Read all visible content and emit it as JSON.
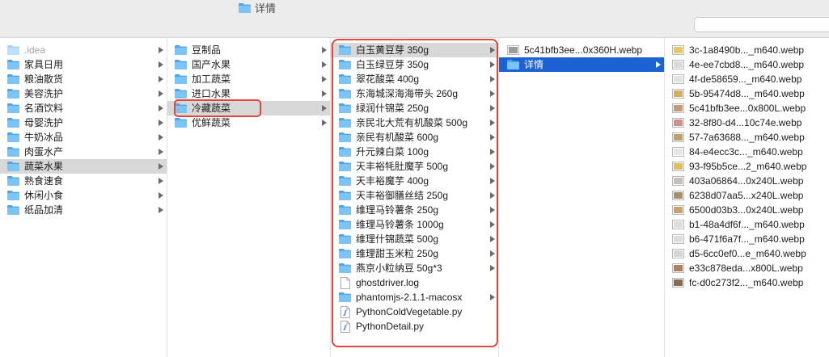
{
  "window": {
    "title": "详情",
    "search": {
      "value": ""
    }
  },
  "colors": {
    "folder": "#7cc3f6",
    "folder_tab": "#4fa4ea",
    "selection_active": "#1c62d4",
    "selection_inactive": "#d8d8d8",
    "annotation": "#e5463a"
  },
  "columns": [
    {
      "items": [
        {
          "name": ".idea",
          "icon": "folder-icon",
          "hidden": true
        },
        {
          "name": "家具日用",
          "icon": "folder-icon"
        },
        {
          "name": "粮油散货",
          "icon": "folder-icon"
        },
        {
          "name": "美容洗护",
          "icon": "folder-icon"
        },
        {
          "name": "名酒饮料",
          "icon": "folder-icon"
        },
        {
          "name": "母婴洗护",
          "icon": "folder-icon"
        },
        {
          "name": "牛奶冰品",
          "icon": "folder-icon"
        },
        {
          "name": "肉蛋水产",
          "icon": "folder-icon"
        },
        {
          "name": "蔬菜水果",
          "icon": "folder-icon",
          "selected": true
        },
        {
          "name": "熟食速食",
          "icon": "folder-icon"
        },
        {
          "name": "休闲小食",
          "icon": "folder-icon"
        },
        {
          "name": "纸品加清",
          "icon": "folder-icon"
        }
      ]
    },
    {
      "items": [
        {
          "name": "豆制品",
          "icon": "folder-icon"
        },
        {
          "name": "国产水果",
          "icon": "folder-icon"
        },
        {
          "name": "加工蔬菜",
          "icon": "folder-icon"
        },
        {
          "name": "进口水果",
          "icon": "folder-icon"
        },
        {
          "name": "冷藏蔬菜",
          "icon": "folder-icon",
          "selected": true
        },
        {
          "name": "优鲜蔬菜",
          "icon": "folder-icon"
        }
      ]
    },
    {
      "items": [
        {
          "name": "白玉黄豆芽 350g",
          "icon": "folder-icon",
          "selected": true
        },
        {
          "name": "白玉绿豆芽 350g",
          "icon": "folder-icon"
        },
        {
          "name": "翠花酸菜 400g",
          "icon": "folder-icon"
        },
        {
          "name": "东海城深海海带头 260g",
          "icon": "folder-icon"
        },
        {
          "name": "绿润什锦菜 250g",
          "icon": "folder-icon"
        },
        {
          "name": "亲民北大荒有机酸菜 500g",
          "icon": "folder-icon"
        },
        {
          "name": "亲民有机酸菜 600g",
          "icon": "folder-icon"
        },
        {
          "name": "升元辣白菜 100g",
          "icon": "folder-icon"
        },
        {
          "name": "天丰裕牦肚魔芋 500g",
          "icon": "folder-icon"
        },
        {
          "name": "天丰裕魔芋 400g",
          "icon": "folder-icon"
        },
        {
          "name": "天丰裕御膳丝结 250g",
          "icon": "folder-icon"
        },
        {
          "name": "维理马铃薯条 250g",
          "icon": "folder-icon"
        },
        {
          "name": "维理马铃薯条 1000g",
          "icon": "folder-icon"
        },
        {
          "name": "维理什锦蔬菜 500g",
          "icon": "folder-icon"
        },
        {
          "name": "维理甜玉米粒 250g",
          "icon": "folder-icon"
        },
        {
          "name": "燕京小粒纳豆 50g*3",
          "icon": "folder-icon"
        },
        {
          "name": "ghostdriver.log",
          "icon": "file-icon"
        },
        {
          "name": "phantomjs-2.1.1-macosx",
          "icon": "folder-icon"
        },
        {
          "name": "PythonColdVegetable.py",
          "icon": "python-file-icon"
        },
        {
          "name": "PythonDetail.py",
          "icon": "python-file-icon"
        }
      ]
    },
    {
      "items": [
        {
          "name": "5c41bfb3ee...0x360H.webp",
          "icon": "image-file-icon",
          "thumb": "#9c9c9c"
        },
        {
          "name": "详情",
          "icon": "folder-icon",
          "active": true
        }
      ]
    },
    {
      "items": [
        {
          "name": "3c-1a8490b..._m640.webp",
          "icon": "image-file-icon",
          "thumb": "#e6c766"
        },
        {
          "name": "4e-ee7cbd8..._m640.webp",
          "icon": "image-file-icon",
          "thumb": "#d9d9d9"
        },
        {
          "name": "4f-de58659..._m640.webp",
          "icon": "image-file-icon",
          "thumb": "#e4e4e4"
        },
        {
          "name": "5b-95474d8..._m640.webp",
          "icon": "image-file-icon",
          "thumb": "#d6ad5a"
        },
        {
          "name": "5c41bfb3ee...0x800L.webp",
          "icon": "image-file-icon",
          "thumb": "#c49a76"
        },
        {
          "name": "32-8f80-d4...10c74e.webp",
          "icon": "image-file-icon",
          "thumb": "#d78c8c"
        },
        {
          "name": "57-7a63688..._m640.webp",
          "icon": "image-file-icon",
          "thumb": "#bf9f6f"
        },
        {
          "name": "84-e4ecc3c..._m640.webp",
          "icon": "image-file-icon",
          "thumb": "#e6e6e6"
        },
        {
          "name": "93-f95b5ce...2_m640.webp",
          "icon": "image-file-icon",
          "thumb": "#dfbf5f"
        },
        {
          "name": "403a06864...0x240L.webp",
          "icon": "image-file-icon",
          "thumb": "#c7beb6"
        },
        {
          "name": "6238d07aa5...x240L.webp",
          "icon": "image-file-icon",
          "thumb": "#a88f6f"
        },
        {
          "name": "6500d03b3...0x240L.webp",
          "icon": "image-file-icon",
          "thumb": "#c8a26a"
        },
        {
          "name": "b1-48a4df6f..._m640.webp",
          "icon": "image-file-icon",
          "thumb": "#dedede"
        },
        {
          "name": "b6-471f6a7f..._m640.webp",
          "icon": "image-file-icon",
          "thumb": "#dcdcdc"
        },
        {
          "name": "d5-6cc0ef0...e_m640.webp",
          "icon": "image-file-icon",
          "thumb": "#d6d6d6"
        },
        {
          "name": "e33c878eda...x800L.webp",
          "icon": "image-file-icon",
          "thumb": "#b07f5f"
        },
        {
          "name": "fc-d0c273f2..._m640.webp",
          "icon": "image-file-icon",
          "thumb": "#8a6a50"
        }
      ]
    }
  ]
}
